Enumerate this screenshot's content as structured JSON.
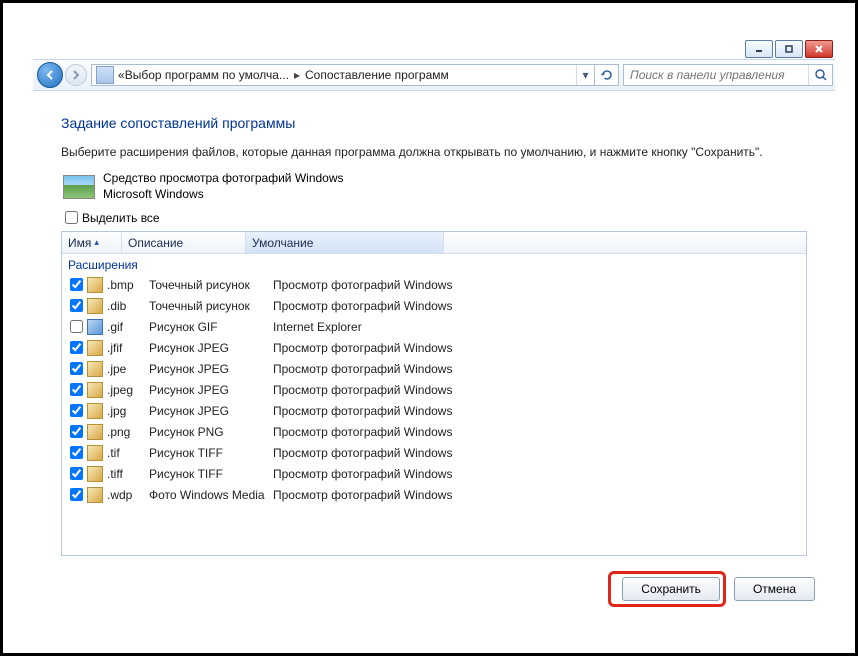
{
  "titlebar": {},
  "breadcrumb": {
    "prev": "Выбор программ по умолча...",
    "current": "Сопоставление программ"
  },
  "search": {
    "placeholder": "Поиск в панели управления"
  },
  "page_title": "Задание сопоставлений программы",
  "page_desc": "Выберите расширения файлов, которые данная программа должна открывать по умолчанию, и нажмите кнопку \"Сохранить\".",
  "program": {
    "name": "Средство просмотра фотографий Windows",
    "vendor": "Microsoft Windows"
  },
  "select_all_label": "Выделить все",
  "columns": {
    "name": "Имя",
    "desc": "Описание",
    "def": "Умолчание"
  },
  "group_header": "Расширения",
  "rows": [
    {
      "checked": true,
      "icon": "img",
      "ext": ".bmp",
      "desc": "Точечный рисунок",
      "def": "Просмотр фотографий Windows"
    },
    {
      "checked": true,
      "icon": "img",
      "ext": ".dib",
      "desc": "Точечный рисунок",
      "def": "Просмотр фотографий Windows"
    },
    {
      "checked": false,
      "icon": "blue",
      "ext": ".gif",
      "desc": "Рисунок GIF",
      "def": "Internet Explorer"
    },
    {
      "checked": true,
      "icon": "img",
      "ext": ".jfif",
      "desc": "Рисунок JPEG",
      "def": "Просмотр фотографий Windows"
    },
    {
      "checked": true,
      "icon": "img",
      "ext": ".jpe",
      "desc": "Рисунок JPEG",
      "def": "Просмотр фотографий Windows"
    },
    {
      "checked": true,
      "icon": "img",
      "ext": ".jpeg",
      "desc": "Рисунок JPEG",
      "def": "Просмотр фотографий Windows"
    },
    {
      "checked": true,
      "icon": "img",
      "ext": ".jpg",
      "desc": "Рисунок JPEG",
      "def": "Просмотр фотографий Windows"
    },
    {
      "checked": true,
      "icon": "img",
      "ext": ".png",
      "desc": "Рисунок PNG",
      "def": "Просмотр фотографий Windows"
    },
    {
      "checked": true,
      "icon": "img",
      "ext": ".tif",
      "desc": "Рисунок TIFF",
      "def": "Просмотр фотографий Windows"
    },
    {
      "checked": true,
      "icon": "img",
      "ext": ".tiff",
      "desc": "Рисунок TIFF",
      "def": "Просмотр фотографий Windows"
    },
    {
      "checked": true,
      "icon": "img",
      "ext": ".wdp",
      "desc": "Фото Windows Media",
      "def": "Просмотр фотографий Windows"
    }
  ],
  "buttons": {
    "save": "Сохранить",
    "cancel": "Отмена"
  }
}
